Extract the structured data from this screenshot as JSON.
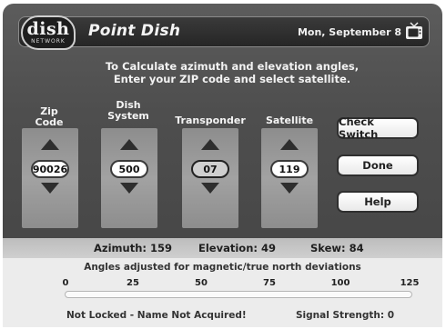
{
  "header": {
    "logo_text": "dish",
    "logo_sub": "NETWORK",
    "title": "Point Dish",
    "date": "Mon, September 8"
  },
  "instructions": {
    "line1": "To Calculate azimuth and elevation angles,",
    "line2": "Enter your ZIP code and select satellite."
  },
  "fields": {
    "zip": {
      "label_line1": "Zip",
      "label_line2": "Code",
      "value": "90026"
    },
    "dish_system": {
      "label_line1": "Dish",
      "label_line2": "System",
      "value": "500"
    },
    "transponder": {
      "label": "Transponder",
      "value": "07"
    },
    "satellite": {
      "label": "Satellite",
      "value": "119"
    }
  },
  "buttons": {
    "check_switch": "Check Switch",
    "done": "Done",
    "help": "Help"
  },
  "readout": {
    "azimuth": "Azimuth: 159",
    "elevation": "Elevation: 49",
    "skew": "Skew: 84"
  },
  "note": "Angles adjusted for magnetic/true north deviations",
  "signal_scale": [
    "0",
    "25",
    "50",
    "75",
    "100",
    "125"
  ],
  "signal_level": 0,
  "status": {
    "lock": "Not Locked - Name Not Acquired!",
    "strength": "Signal Strength:  0"
  },
  "icons": {
    "tv": "tv-icon",
    "up": "arrow-up-icon",
    "down": "arrow-down-icon"
  }
}
